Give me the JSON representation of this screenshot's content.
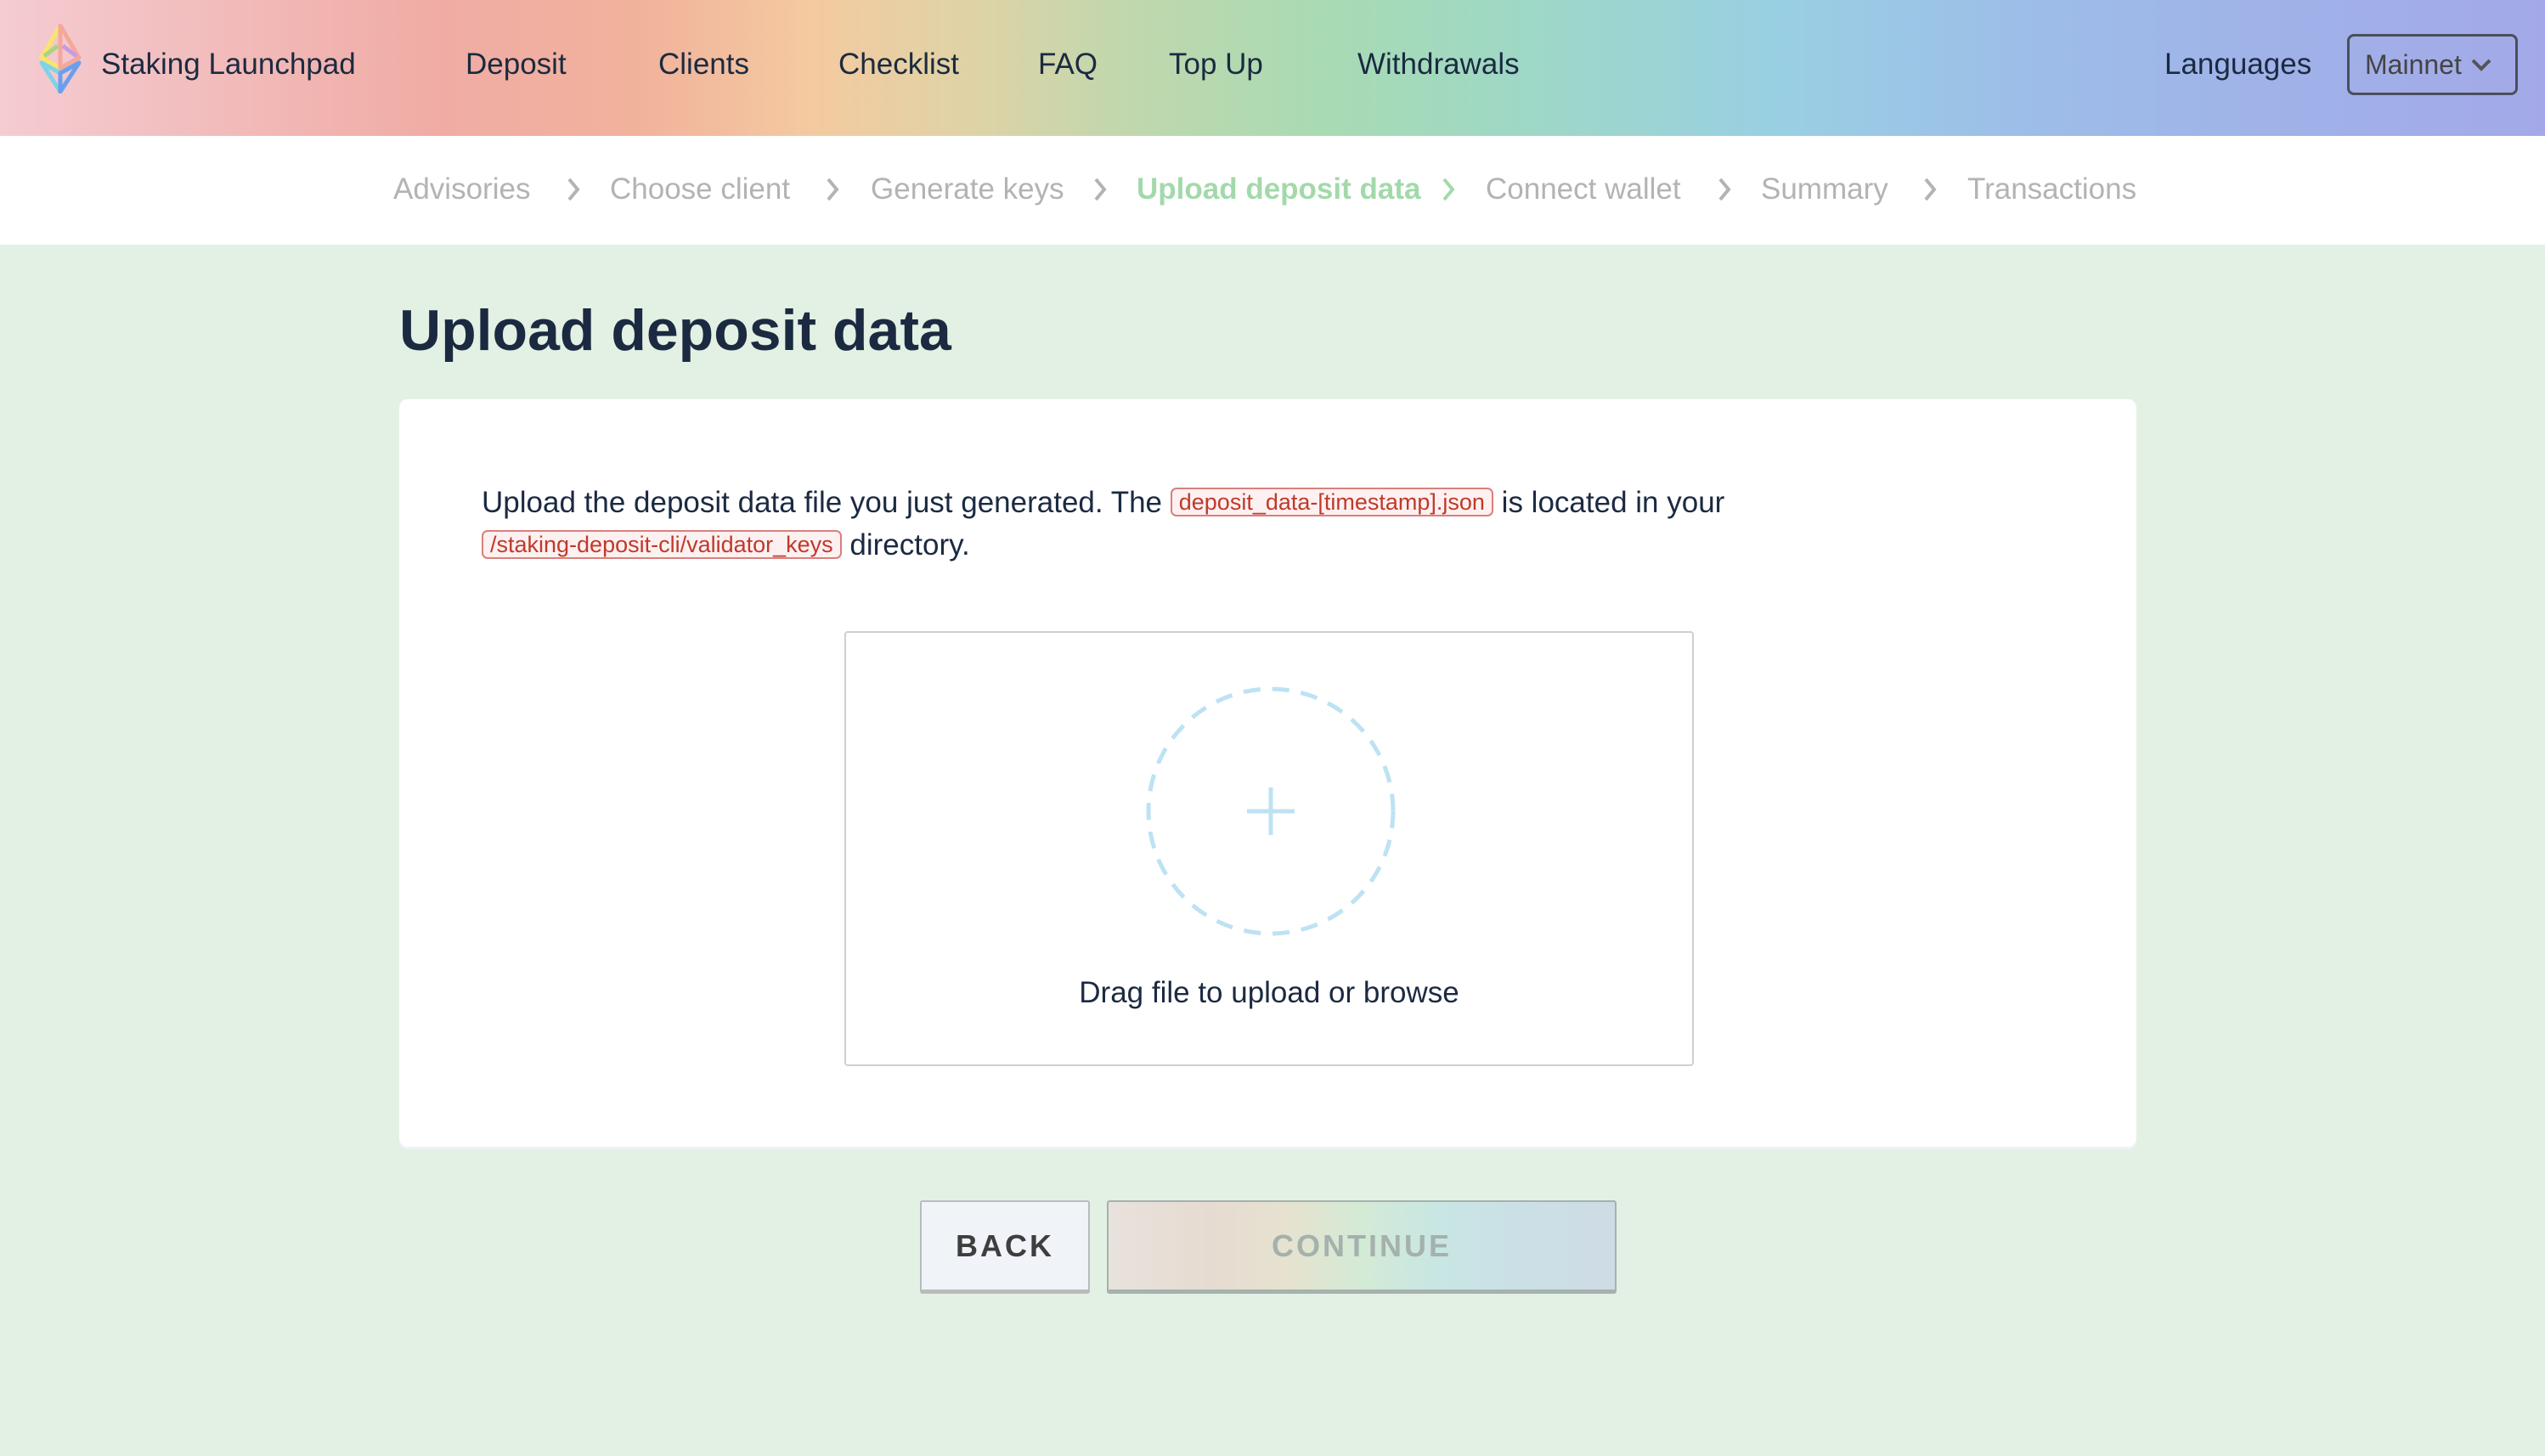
{
  "header": {
    "brand": "Staking Launchpad",
    "logo_icon": "ethereum-diamond-icon",
    "nav": [
      {
        "label": "Deposit"
      },
      {
        "label": "Clients"
      },
      {
        "label": "Checklist"
      },
      {
        "label": "FAQ"
      },
      {
        "label": "Top Up"
      },
      {
        "label": "Withdrawals"
      }
    ],
    "languages_label": "Languages",
    "network": {
      "selected": "Mainnet",
      "icon": "chevron-down-icon"
    }
  },
  "stepper": {
    "steps": [
      {
        "label": "Advisories",
        "state": "inactive"
      },
      {
        "label": "Choose client",
        "state": "inactive"
      },
      {
        "label": "Generate keys",
        "state": "inactive"
      },
      {
        "label": "Upload deposit data",
        "state": "active"
      },
      {
        "label": "Connect wallet",
        "state": "inactive"
      },
      {
        "label": "Summary",
        "state": "inactive"
      },
      {
        "label": "Transactions",
        "state": "inactive"
      }
    ],
    "active_color": "#a3d9aa",
    "inactive_color": "#b3b3b3"
  },
  "page": {
    "title": "Upload deposit data",
    "description": {
      "part1": "Upload the deposit data file you just generated. The ",
      "code1": "deposit_data-[timestamp].json",
      "part2": " is located in your ",
      "code2": "/staking-deposit-cli/validator_keys",
      "part3": " directory."
    },
    "dropzone": {
      "label": "Drag file to upload or browse",
      "icon": "plus-icon"
    }
  },
  "actions": {
    "back_label": "BACK",
    "continue_label": "CONTINUE",
    "continue_disabled": true
  }
}
